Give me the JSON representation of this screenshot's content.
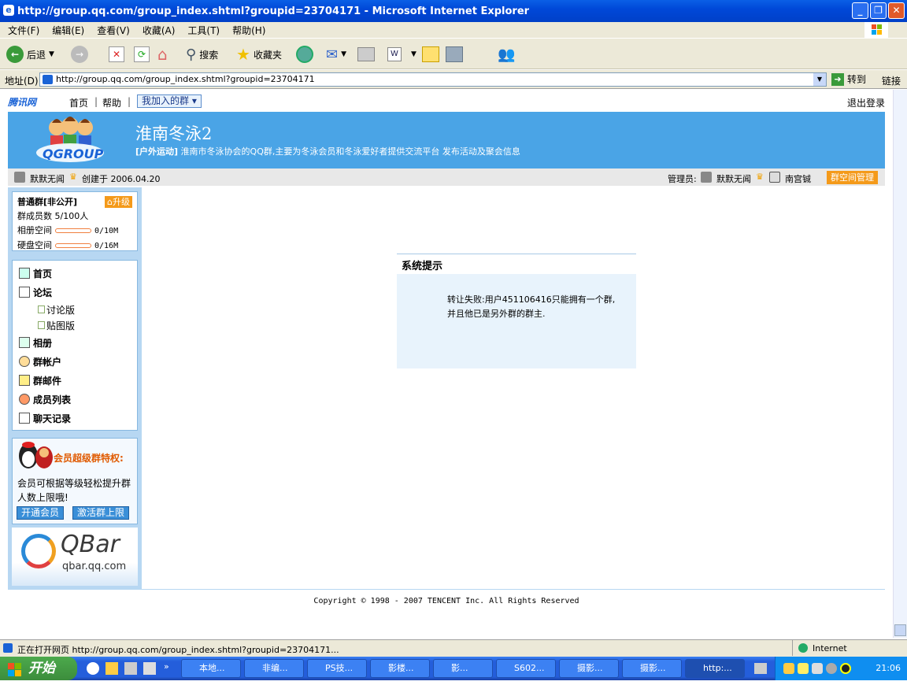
{
  "window": {
    "title": "http://group.qq.com/group_index.shtml?groupid=23704171 - Microsoft Internet Explorer"
  },
  "menu": [
    "文件(F)",
    "编辑(E)",
    "查看(V)",
    "收藏(A)",
    "工具(T)",
    "帮助(H)"
  ],
  "toolbar": {
    "back": "后退",
    "search": "搜索",
    "favorites": "收藏夹"
  },
  "address": {
    "label": "地址(D)",
    "url": "http://group.qq.com/group_index.shtml?groupid=23704171",
    "go": "转到",
    "links": "链接"
  },
  "site": {
    "logo": "腾讯网",
    "nav_home": "首页",
    "nav_help": "帮助",
    "my_groups": "我加入的群 ▾",
    "logout": "退出登录"
  },
  "banner": {
    "logo": "QGROUP",
    "group_name": "淮南冬泳2",
    "category": "[户外运动]",
    "description": "淮南市冬泳协会的QQ群,主要为冬泳会员和冬泳爱好者提供交流平台 发布活动及聚会信息"
  },
  "info": {
    "creator": "默默无闻",
    "created": "创建于  2006.04.20",
    "admin_label": "管理员:",
    "admin1": "默默无闻",
    "admin2": "南宫铖",
    "manage_button": "群空间管理"
  },
  "group_stats": {
    "type": "普通群[非公开]",
    "upgrade": "升级",
    "members_label": "群成员数",
    "members": "5/100人",
    "album_label": "相册空间",
    "album": "0/10M",
    "album_fill": 0,
    "disk_label": "硬盘空间",
    "disk": "0/16M",
    "disk_fill": 0
  },
  "nav": {
    "home": "首页",
    "forum": "论坛",
    "discussion": "讨论版",
    "gallery": "贴图版",
    "album": "相册",
    "account": "群帐户",
    "mail": "群邮件",
    "members": "成员列表",
    "chat": "聊天记录"
  },
  "promo": {
    "title": "会员超级群特权:",
    "text": "会员可根据等级轻松提升群人数上限哦!",
    "btn1": "开通会员",
    "btn2": "激活群上限"
  },
  "qbar": {
    "logo": "QBar",
    "url": "qbar.qq.com"
  },
  "system": {
    "title": "系统提示",
    "line1": "转让失败:用户451106416只能拥有一个群,",
    "line2": "并且他已是另外群的群主."
  },
  "footer": {
    "copyright": "Copyright © 1998 - 2007 TENCENT Inc. All Rights Reserved"
  },
  "status": {
    "text": "正在打开网页 http://group.qq.com/group_index.shtml?groupid=23704171...",
    "zone": "Internet"
  },
  "taskbar": {
    "start": "开始",
    "tasks": [
      "本地...",
      "非编...",
      "PS技...",
      "影楼...",
      "影...",
      "S602...",
      "摄影...",
      "摄影...",
      "http:..."
    ],
    "clock": "21:06"
  }
}
